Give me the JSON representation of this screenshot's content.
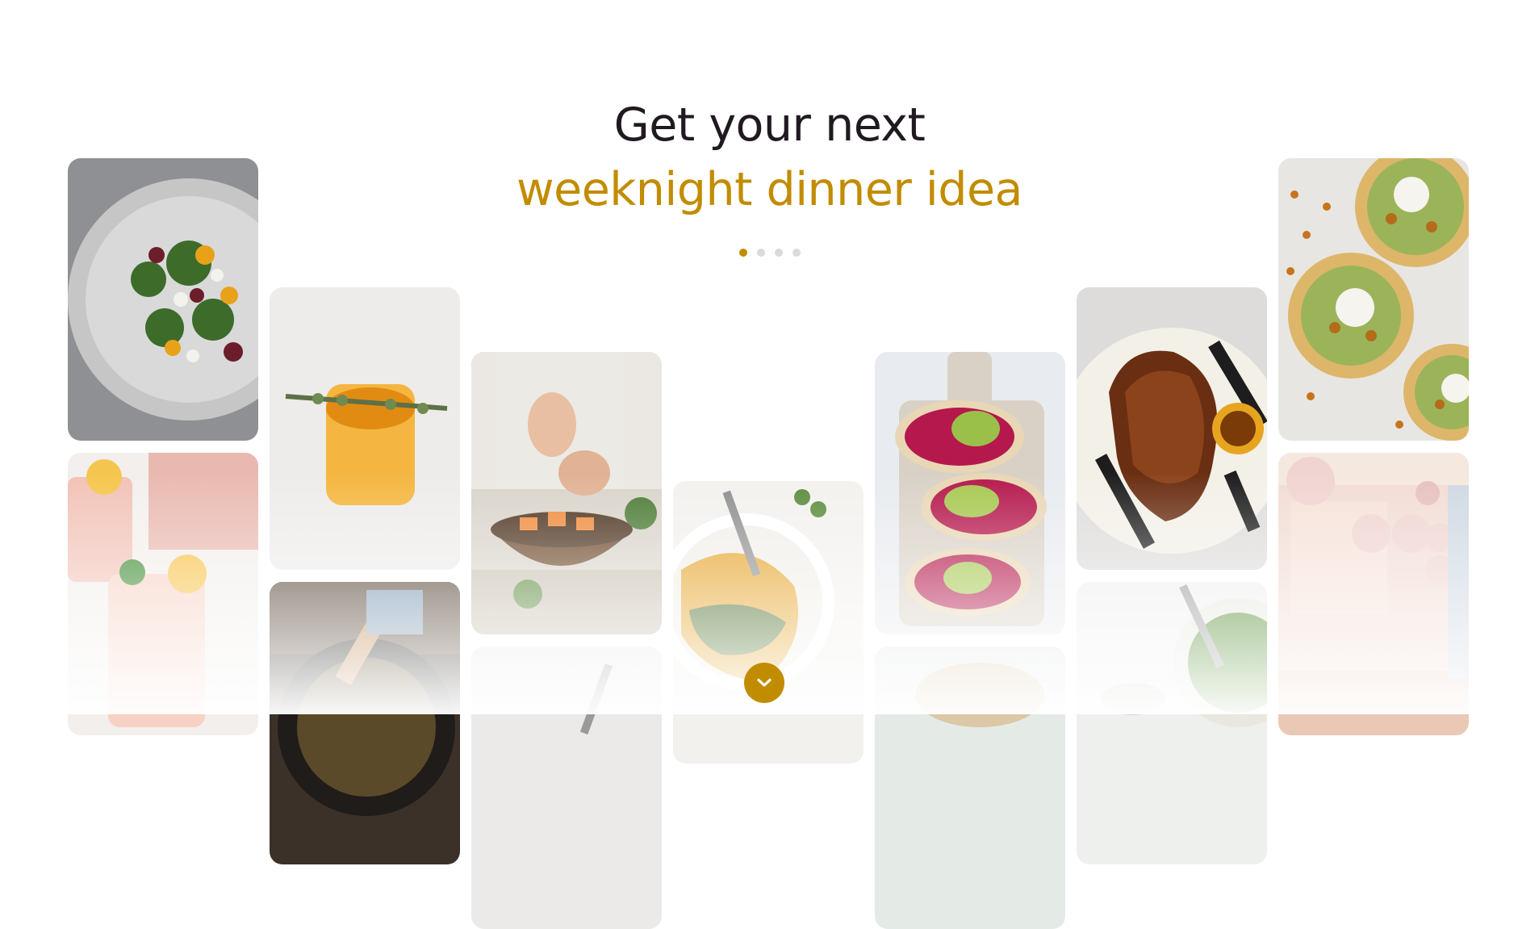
{
  "colors": {
    "accent": "#c28c00",
    "heading": "#211922"
  },
  "hero": {
    "title_line1": "Get your next",
    "title_line2": "weeknight dinner idea",
    "carousel": {
      "dot_count": 4,
      "active_index": 0
    },
    "scroll_button_icon": "chevron-down-icon"
  },
  "pins": [
    {
      "name": "beet-salad",
      "subject": "beet and goat cheese salad"
    },
    {
      "name": "peach-drink",
      "subject": "peach lemonade with mint"
    },
    {
      "name": "orange-drink",
      "subject": "orange drink with thyme"
    },
    {
      "name": "iron-skillet",
      "subject": "cast iron skillet"
    },
    {
      "name": "bowl-prep",
      "subject": "hands seasoning a wooden bowl"
    },
    {
      "name": "hummus-bowl",
      "subject": "pumpkin hummus bowl"
    },
    {
      "name": "beet-toast",
      "subject": "beet and avocado toast"
    },
    {
      "name": "grilled-chicken",
      "subject": "grilled chicken"
    },
    {
      "name": "pea-bowl",
      "subject": "green pea bowl"
    },
    {
      "name": "chickpea-flatbread",
      "subject": "chickpea flatbreads"
    },
    {
      "name": "party-room",
      "subject": "pink balloon party room"
    }
  ]
}
